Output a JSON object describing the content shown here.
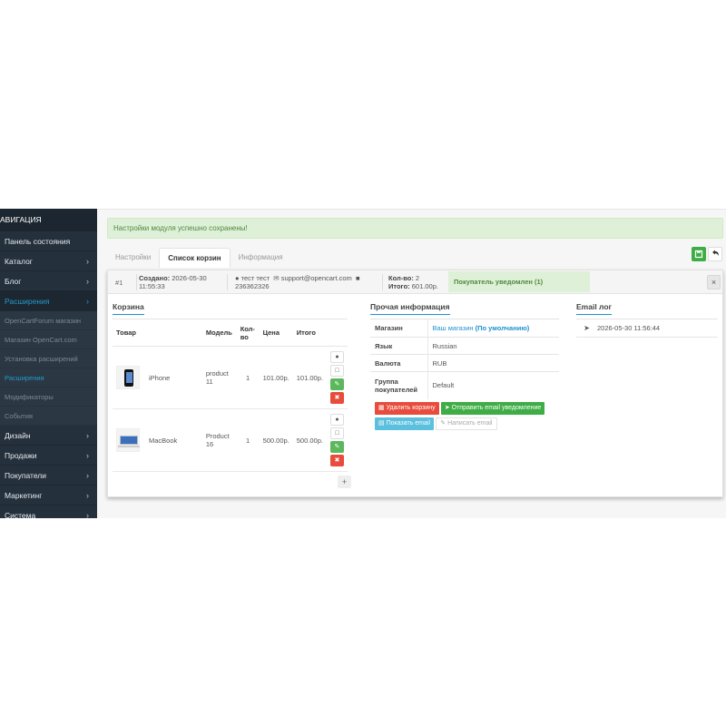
{
  "sidebar": {
    "header": "АВИГАЦИЯ",
    "items": [
      {
        "label": "Панель состояния",
        "chevron": ""
      },
      {
        "label": "Каталог",
        "chevron": "›"
      },
      {
        "label": "Блог",
        "chevron": "›"
      },
      {
        "label": "Расширения",
        "chevron": "›"
      }
    ],
    "subitems": [
      {
        "label": "OpenCartForum магазин"
      },
      {
        "label": "Магазин OpenCart.com"
      },
      {
        "label": "Установка расширений"
      },
      {
        "label": "Расширения"
      },
      {
        "label": "Модификаторы"
      },
      {
        "label": "События"
      }
    ],
    "items_after": [
      {
        "label": "Дизайн",
        "chevron": "›"
      },
      {
        "label": "Продажи",
        "chevron": "›"
      },
      {
        "label": "Покупатели",
        "chevron": "›"
      },
      {
        "label": "Маркетинг",
        "chevron": "›"
      },
      {
        "label": "Система",
        "chevron": "›"
      }
    ]
  },
  "alert": {
    "text": "Настройки модуля успешно сохранены!"
  },
  "tabs": [
    {
      "label": "Настройки"
    },
    {
      "label": "Список корзин"
    },
    {
      "label": "Информация"
    }
  ],
  "toolbar": {
    "save_icon": "save-icon",
    "back_icon": "reply-icon"
  },
  "cart": {
    "number": "#1",
    "created_label": "Создано:",
    "created_value": "2026-05-30 11:55:33",
    "customer_name": "тест тест",
    "customer_email": "support@opencart.com",
    "customer_phone": "236362326",
    "qty_label": "Кол-во:",
    "qty_value": "2",
    "total_label": "Итого:",
    "total_value": "601.00р.",
    "notified": "Покупатель уведомлен (1)",
    "close": "×"
  },
  "basket": {
    "title": "Корзина",
    "columns": [
      "Товар",
      "Модель",
      "Кол-во",
      "Цена",
      "Итого"
    ],
    "rows": [
      {
        "name": "iPhone",
        "model": "product 11",
        "qty": "1",
        "price": "101.00р.",
        "total": "101.00р."
      },
      {
        "name": "MacBook",
        "model": "Product 16",
        "qty": "1",
        "price": "500.00р.",
        "total": "500.00р."
      }
    ],
    "add": "+"
  },
  "other_info": {
    "title": "Прочая информация",
    "store_label": "Магазин",
    "store_value": "Ваш магазин",
    "store_default": "(По умолчанию)",
    "language_label": "Язык",
    "language_value": "Russian",
    "currency_label": "Валюта",
    "currency_value": "RUB",
    "group_label": "Группа покупателей",
    "group_value": "Default",
    "btn_delete": "Удалить корзину",
    "btn_send": "Отправить email уведомление",
    "btn_show": "Показать email",
    "btn_write": "Написать email"
  },
  "email_log": {
    "title": "Email лог",
    "entries": [
      {
        "date": "2026-05-30 11:56:44"
      }
    ]
  }
}
